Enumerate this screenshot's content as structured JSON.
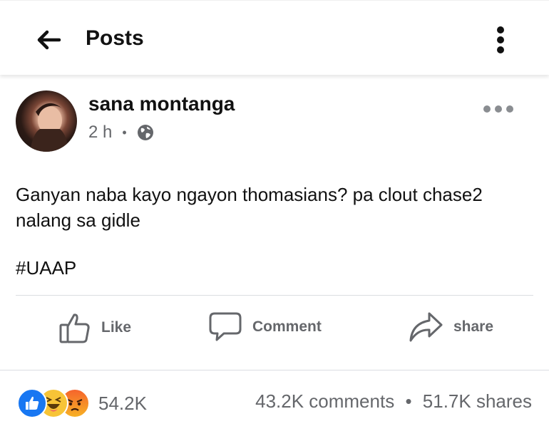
{
  "header": {
    "title": "Posts"
  },
  "post": {
    "author": "sana montanga",
    "time": "2 h",
    "separator": "•",
    "text": "Ganyan naba kayo ngayon thomasians? pa clout chase2 nalang sa gidle",
    "hashtag": "#UAAP"
  },
  "actions": {
    "like": "Like",
    "comment": "Comment",
    "share": "share"
  },
  "stats": {
    "reactions": "54.2K",
    "comments": "43.2K comments",
    "separator": "•",
    "shares": "51.7K shares"
  },
  "colors": {
    "like_blue": "#1877f2",
    "meta_gray": "#65676b",
    "haha_yellow": "#f7c437",
    "angry_orange": "#f6642c"
  },
  "icons": [
    "back-arrow-icon",
    "kebab-menu-icon",
    "globe-icon",
    "more-horizontal-icon",
    "thumbs-up-icon",
    "comment-bubble-icon",
    "share-arrow-icon",
    "like-reaction-icon",
    "haha-reaction-icon",
    "angry-reaction-icon"
  ]
}
